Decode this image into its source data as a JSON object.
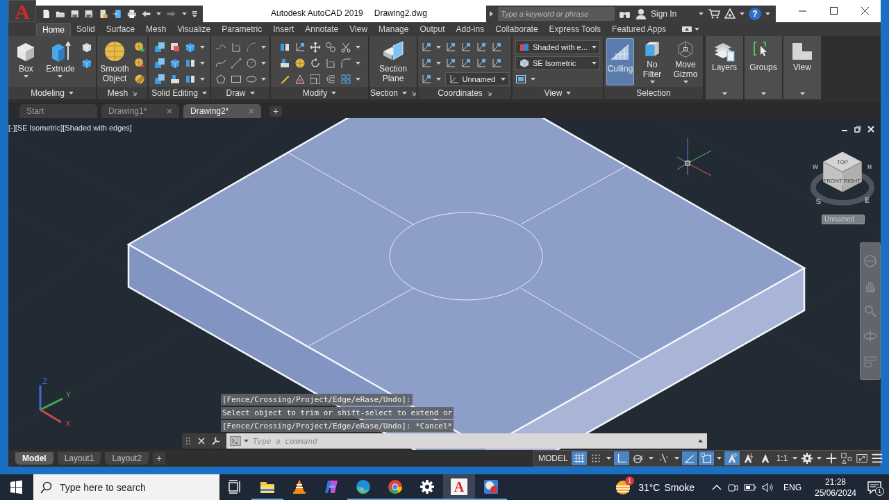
{
  "app_button": {
    "label": "A"
  },
  "window": {
    "app_title": "Autodesk AutoCAD 2019",
    "file_title": "Drawing2.dwg"
  },
  "infocenter": {
    "search_placeholder": "Type a keyword or phrase",
    "sign_in": "Sign In",
    "help": "?"
  },
  "ribbon_tabs": [
    {
      "label": "Home",
      "selected": true
    },
    {
      "label": "Solid",
      "selected": false
    },
    {
      "label": "Surface",
      "selected": false
    },
    {
      "label": "Mesh",
      "selected": false
    },
    {
      "label": "Visualize",
      "selected": false
    },
    {
      "label": "Parametric",
      "selected": false
    },
    {
      "label": "Insert",
      "selected": false
    },
    {
      "label": "Annotate",
      "selected": false
    },
    {
      "label": "View",
      "selected": false
    },
    {
      "label": "Manage",
      "selected": false
    },
    {
      "label": "Output",
      "selected": false
    },
    {
      "label": "Add-ins",
      "selected": false
    },
    {
      "label": "Collaborate",
      "selected": false
    },
    {
      "label": "Express Tools",
      "selected": false
    },
    {
      "label": "Featured Apps",
      "selected": false
    }
  ],
  "ribbon_panels": [
    {
      "kind": "full",
      "title": "Modeling",
      "expandable": true,
      "launcher": false,
      "buttons": [
        {
          "label": "Box",
          "on": false,
          "dropdown": true
        },
        {
          "label": "Extrude",
          "on": false,
          "dropdown": true
        }
      ]
    },
    {
      "kind": "full",
      "title": "Mesh",
      "expandable": false,
      "launcher": true,
      "buttons": [
        {
          "label": "Smooth Object",
          "on": false,
          "dropdown": false
        }
      ]
    },
    {
      "kind": "full",
      "title": "Solid Editing",
      "expandable": true,
      "launcher": false
    },
    {
      "kind": "full",
      "title": "Draw",
      "expandable": true,
      "launcher": false
    },
    {
      "kind": "full",
      "title": "Modify",
      "expandable": true,
      "launcher": false
    },
    {
      "kind": "full",
      "title": "Section",
      "expandable": true,
      "launcher": true,
      "buttons": [
        {
          "label": "Section Plane",
          "on": false,
          "dropdown": false
        }
      ]
    },
    {
      "kind": "full",
      "title": "Coordinates",
      "expandable": false,
      "launcher": true,
      "dropdowns": [
        {
          "value": "Unnamed"
        }
      ]
    },
    {
      "kind": "full",
      "title": "View",
      "expandable": true,
      "launcher": false,
      "dropdowns": [
        {
          "value": "Shaded with e..."
        },
        {
          "value": "SE Isometric"
        }
      ]
    },
    {
      "kind": "full",
      "title": "Selection",
      "expandable": false,
      "launcher": false,
      "buttons": [
        {
          "label": "Culling",
          "on": true,
          "dropdown": false
        },
        {
          "label": "No Filter",
          "on": false,
          "dropdown": true
        },
        {
          "label": "Move Gizmo",
          "on": false,
          "dropdown": true
        }
      ]
    },
    {
      "kind": "collapsed",
      "title": "Layers"
    },
    {
      "kind": "collapsed",
      "title": "Groups"
    },
    {
      "kind": "collapsed",
      "title": "View"
    }
  ],
  "file_tabs": [
    {
      "label": "Start",
      "selected": false,
      "closable": false
    },
    {
      "label": "Drawing1*",
      "selected": false,
      "closable": true
    },
    {
      "label": "Drawing2*",
      "selected": true,
      "closable": true
    }
  ],
  "new_tab": "+",
  "viewport": {
    "label": "[-][SE Isometric][Shaded with edges]",
    "viewcube": {
      "faces": [
        "TOP",
        "FRONT",
        "RIGHT"
      ],
      "compass": [
        "W",
        "N",
        "S",
        "E"
      ],
      "ucs_menu": "Unnamed"
    },
    "ucs_axes": [
      "Z",
      "Y",
      "X"
    ]
  },
  "command_line": {
    "history": [
      "[Fence/Crossing/Project/Edge/eRase/Undo]:",
      "Select object to trim or shift-select to extend or",
      "[Fence/Crossing/Project/Edge/eRase/Undo]: *Cancel*"
    ],
    "placeholder": "Type a command"
  },
  "layout_tabs": [
    {
      "label": "Model",
      "selected": true
    },
    {
      "label": "Layout1",
      "selected": false
    },
    {
      "label": "Layout2",
      "selected": false
    }
  ],
  "add_layout": "+",
  "status_bar": {
    "space": "MODEL",
    "scale": "1:1",
    "toggles": [
      {
        "on": true
      },
      {
        "on": false
      },
      {
        "on": true
      },
      {
        "on": false
      },
      {
        "on": false
      },
      {
        "on": true
      },
      {
        "on": true
      },
      {
        "on": true
      },
      {
        "on": false
      },
      {
        "on": false
      }
    ]
  },
  "taskbar": {
    "search_placeholder": "Type here to search",
    "apps": [
      {
        "running": true,
        "selected": false
      },
      {
        "running": false,
        "selected": false
      },
      {
        "running": false,
        "selected": false
      },
      {
        "running": true,
        "selected": false
      },
      {
        "running": true,
        "selected": false
      },
      {
        "running": true,
        "selected": false
      },
      {
        "label": "A",
        "running": true,
        "selected": true
      },
      {
        "running": true,
        "selected": false
      }
    ],
    "weather": {
      "temperature": "31°C",
      "condition": "Smoke",
      "badge": "1"
    },
    "language": "ENG",
    "time": "21:28",
    "date": "25/06/2024",
    "notifications": "1"
  }
}
